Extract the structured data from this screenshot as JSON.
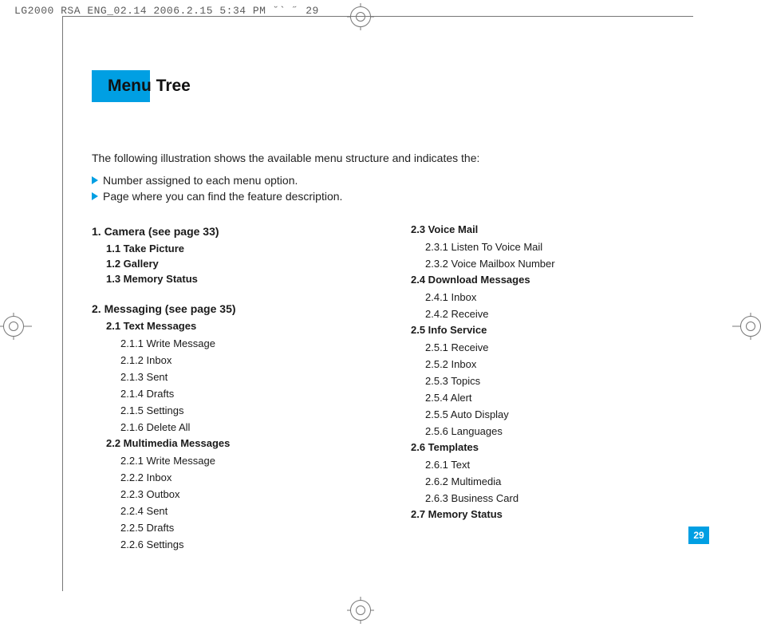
{
  "header": "LG2000 RSA ENG_02.14  2006.2.15 5:34 PM  ˘` ˝ 29",
  "title": "Menu Tree",
  "intro": "The following illustration shows the available menu structure and indicates the:",
  "bullets": [
    "Number assigned to each menu option.",
    "Page where you can find the feature description."
  ],
  "col1": {
    "s1": {
      "head": "1.  Camera (see page 33)",
      "items": [
        "1.1 Take Picture",
        "1.2 Gallery",
        "1.3 Memory Status"
      ]
    },
    "s2": {
      "head": "2.  Messaging (see page 35)",
      "g1": {
        "head": "2.1 Text Messages",
        "items": [
          "2.1.1 Write Message",
          "2.1.2 Inbox",
          "2.1.3 Sent",
          "2.1.4 Drafts",
          "2.1.5 Settings",
          "2.1.6 Delete All"
        ]
      },
      "g2": {
        "head": "2.2 Multimedia Messages",
        "items": [
          "2.2.1 Write Message",
          "2.2.2 Inbox",
          "2.2.3 Outbox",
          "2.2.4 Sent",
          "2.2.5 Drafts",
          "2.2.6 Settings"
        ]
      }
    }
  },
  "col2": {
    "g3": {
      "head": "2.3 Voice Mail",
      "items": [
        "2.3.1 Listen To Voice Mail",
        "2.3.2 Voice Mailbox Number"
      ]
    },
    "g4": {
      "head": "2.4 Download Messages",
      "items": [
        "2.4.1 Inbox",
        "2.4.2 Receive"
      ]
    },
    "g5": {
      "head": "2.5 Info Service",
      "items": [
        "2.5.1 Receive",
        "2.5.2 Inbox",
        "2.5.3 Topics",
        "2.5.4 Alert",
        "2.5.5 Auto Display",
        "2.5.6 Languages"
      ]
    },
    "g6": {
      "head": "2.6 Templates",
      "items": [
        "2.6.1 Text",
        "2.6.2 Multimedia",
        "2.6.3 Business Card"
      ]
    },
    "g7": {
      "head": "2.7 Memory Status"
    }
  },
  "page_number": "29"
}
